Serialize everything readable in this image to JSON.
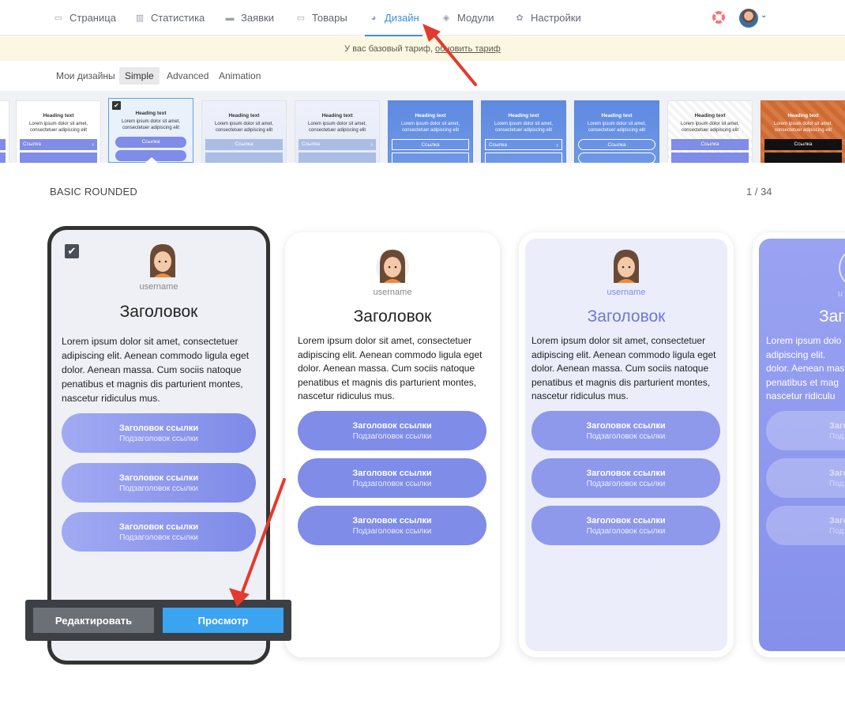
{
  "nav": {
    "items": [
      {
        "label": "Страница",
        "icon": "page-icon"
      },
      {
        "label": "Статистика",
        "icon": "stats-icon"
      },
      {
        "label": "Заявки",
        "icon": "requests-icon"
      },
      {
        "label": "Товары",
        "icon": "products-icon"
      },
      {
        "label": "Дизайн",
        "icon": "palette-icon"
      },
      {
        "label": "Модули",
        "icon": "modules-icon"
      },
      {
        "label": "Настройки",
        "icon": "gear-icon"
      }
    ],
    "active": "Дизайн"
  },
  "banner": {
    "text": "У вас базовый тариф,",
    "link": "обновить тариф"
  },
  "subtabs": [
    {
      "label": "Мои дизайны"
    },
    {
      "label": "Simple"
    },
    {
      "label": "Advanced"
    },
    {
      "label": "Animation"
    }
  ],
  "thumbnails": {
    "heading": "Heading text",
    "text": "Lorem ipsum dolor sit amet, consectetuer adipiscing elit",
    "button": "Ссылка"
  },
  "section": {
    "title": "BASIC ROUNDED",
    "pager": "1 / 34"
  },
  "phone": {
    "username": "username",
    "title": "Заголовок",
    "text": "Lorem ipsum dolor sit amet, consectetuer adipiscing elit. Aenean commodo ligula eget dolor. Aenean massa. Cum sociis natoque penatibus et magnis dis parturient montes, nascetur ridiculus mus.",
    "link_title": "Заголовок ссылки",
    "link_subtitle": "Подзаголовок ссылки",
    "text_partial": [
      "Lorem ipsum dolo",
      "adipiscing elit.",
      "dolor. Aenean mas",
      "penatibus et mag",
      "nascetur ridiculu"
    ],
    "title_partial": "Заг",
    "link_title_partial": "Загол",
    "link_subtitle_partial": "Подзаг"
  },
  "actions": {
    "edit": "Редактировать",
    "view": "Просмотр"
  },
  "colors": {
    "accent": "#3d8ee6",
    "link_purple": "#7f8ce8",
    "view_button": "#3aa4f1"
  }
}
